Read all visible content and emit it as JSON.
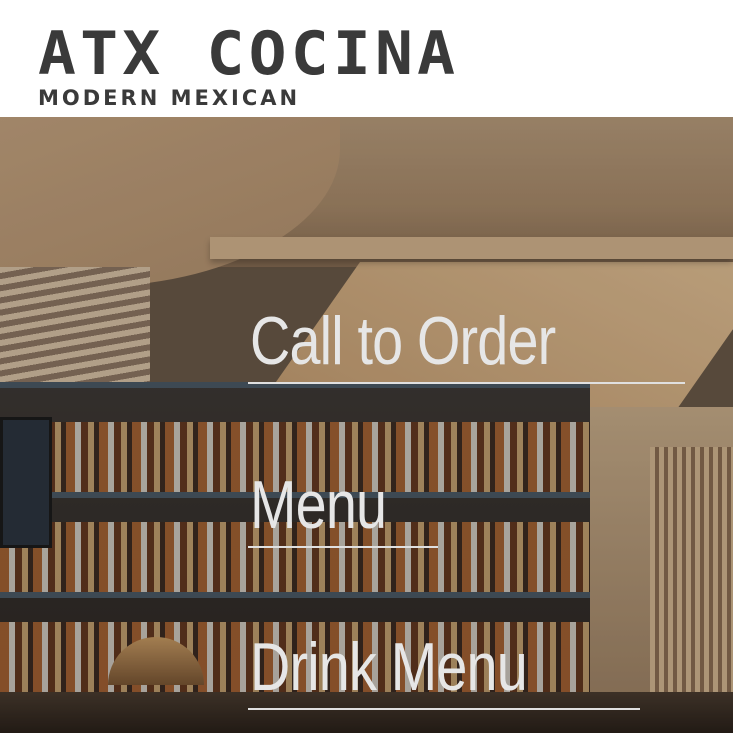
{
  "logo": {
    "name": "ATX COCINA",
    "tagline": "MODERN MEXICAN"
  },
  "nav": {
    "items": [
      {
        "label": "Call to Order"
      },
      {
        "label": "Menu"
      },
      {
        "label": "Drink Menu"
      }
    ]
  },
  "colors": {
    "logo": "#3a3a3a",
    "link_text": "#e6e6e6",
    "underline": "#e0e0e0",
    "header_bg": "#ffffff"
  }
}
